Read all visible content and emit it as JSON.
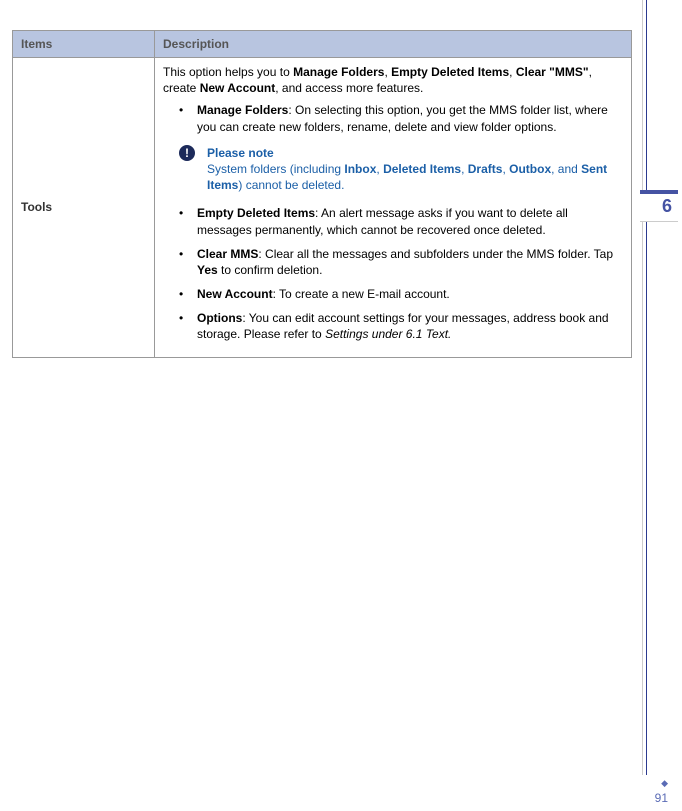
{
  "table": {
    "headers": {
      "items": "Items",
      "description": "Description"
    },
    "row": {
      "label": "Tools",
      "intro_pre": "This option helps you to ",
      "intro_b1": "Manage Folders",
      "intro_sep1": ", ",
      "intro_b2": "Empty Deleted Items",
      "intro_sep2": ", ",
      "intro_b3": "Clear \"MMS\"",
      "intro_mid": ", create ",
      "intro_b4": "New Account",
      "intro_post": ", and access more features.",
      "bullets": {
        "b1_title": "Manage Folders",
        "b1_body": ": On selecting this option, you get the MMS folder list, where you can create new folders, rename, delete and view folder options.",
        "b2_title": "Empty Deleted Items",
        "b2_body": ": An alert message asks if you want to delete all messages permanently, which cannot be recovered once deleted.",
        "b3_title": "Clear MMS",
        "b3_body_pre": ": Clear all the messages and subfolders under the MMS folder. Tap ",
        "b3_yes": "Yes",
        "b3_body_post": " to confirm deletion.",
        "b4_title": "New Account",
        "b4_body": ": To create a new E-mail account.",
        "b5_title": "Options",
        "b5_body_pre": ": You can edit account settings for your messages, address book and storage. Please refer to ",
        "b5_ref": "Settings under 6.1 Text.",
        "b5_body_post": ""
      },
      "note": {
        "title": "Please note",
        "pre": "System folders (including ",
        "f1": "Inbox",
        "s1": ", ",
        "f2": "Deleted Items",
        "s2": ", ",
        "f3": "Drafts",
        "s3": ", ",
        "f4": "Outbox",
        "s4": ", and ",
        "f5": "Sent Items",
        "post": ") cannot be deleted."
      }
    }
  },
  "chapter": "6",
  "page_number": "91",
  "diamond": "◆"
}
